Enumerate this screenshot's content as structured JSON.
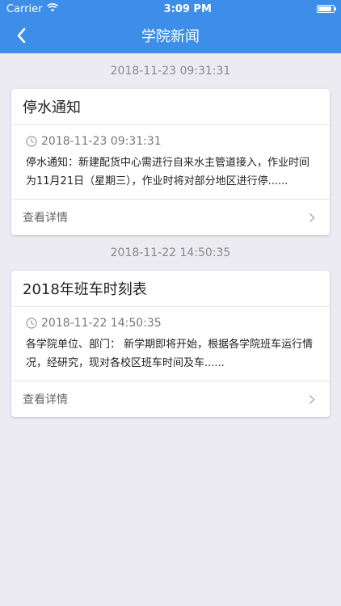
{
  "status_bar": {
    "carrier": "Carrier",
    "time": "3:09 PM",
    "battery_level": 0.9
  },
  "nav": {
    "title": "学院新闻"
  },
  "news": [
    {
      "date_header": "2018-11-23 09:31:31",
      "title": "停水通知",
      "timestamp": "2018-11-23 09:31:31",
      "summary": "停水通知：新建配货中心需进行自来水主管道接入，作业时间为11月21日（星期三），作业时将对部分地区进行停......",
      "link_label": "查看详情"
    },
    {
      "date_header": "2018-11-22 14:50:35",
      "title": "2018年班车时刻表",
      "timestamp": "2018-11-22 14:50:35",
      "summary": "各学院单位、部门： 新学期即将开始，根据各学院班车运行情况，经研究，现对各校区班车时间及车......",
      "link_label": "查看详情"
    }
  ]
}
